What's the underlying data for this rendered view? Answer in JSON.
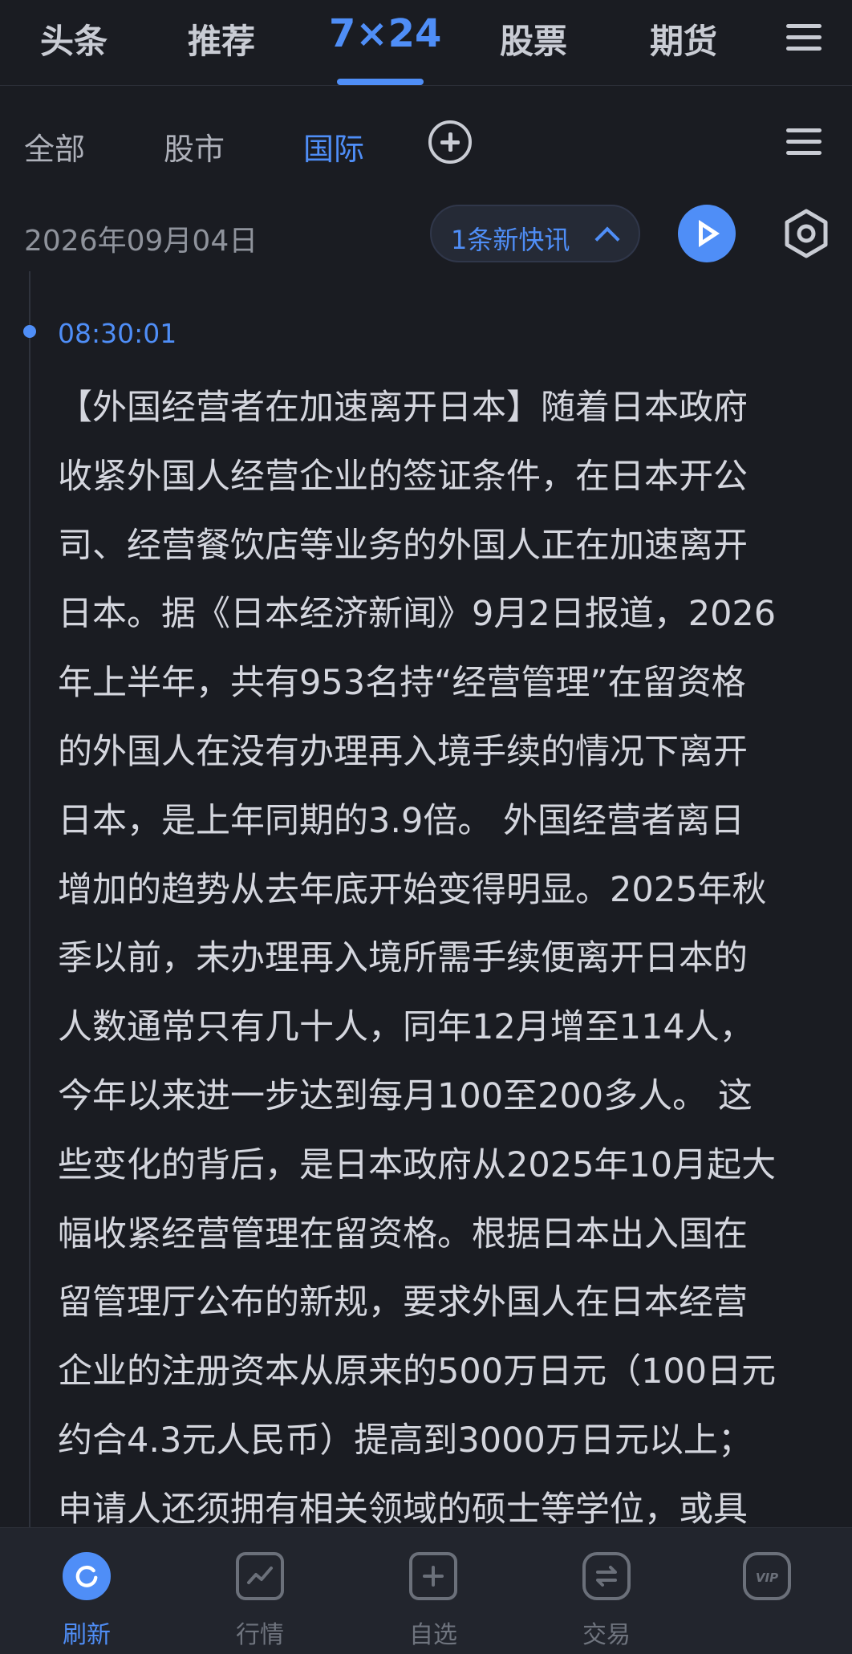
{
  "top_nav": {
    "tabs": [
      {
        "label": "头条"
      },
      {
        "label": "推荐"
      },
      {
        "label": "7×24"
      },
      {
        "label": "股票"
      },
      {
        "label": "期货"
      }
    ],
    "active_index": 2,
    "menu_icon": "hamburger-menu-icon"
  },
  "sub_nav": {
    "tabs": [
      {
        "label": "全部"
      },
      {
        "label": "股市"
      },
      {
        "label": "国际"
      }
    ],
    "active_index": 2,
    "add_icon": "plus-circle-icon",
    "menu_icon": "hamburger-menu-icon"
  },
  "toolbar": {
    "date": "2026年09月04日",
    "new_flash_label": "1条新快讯",
    "play_icon": "play-icon",
    "settings_icon": "hexagon-settings-icon"
  },
  "news": {
    "time": "08:30:01",
    "lines": [
      "【外国经营者在加速离开日本】随着日本政府",
      "收紧外国人经营企业的签证条件，在日本开公",
      "司、经营餐饮店等业务的外国人正在加速离开",
      "日本。据《日本经济新闻》9月2日报道，2026",
      "年上半年，共有953名持“经营管理”在留资格",
      "的外国人在没有办理再入境手续的情况下离开",
      "日本，是上年同期的3.9倍。 外国经营者离日",
      "增加的趋势从去年底开始变得明显。2025年秋",
      "季以前，未办理再入境所需手续便离开日本的",
      "人数通常只有几十人，同年12月增至114人，",
      "今年以来进一步达到每月100至200多人。 这",
      "些变化的背后，是日本政府从2025年10月起大",
      "幅收紧经营管理在留资格。根据日本出入国在",
      "留管理厅公布的新规，要求外国人在日本经营",
      "企业的注册资本从原来的500万日元（100日元",
      "约合4.3元人民币）提高到3000万日元以上；",
      "申请人还须拥有相关领域的硕士等学位，或具"
    ]
  },
  "bottom_nav": {
    "items": [
      {
        "label": "刷新",
        "icon": "refresh-icon"
      },
      {
        "label": "行情",
        "icon": "market-chart-icon"
      },
      {
        "label": "自选",
        "icon": "add-watchlist-icon"
      },
      {
        "label": "交易",
        "icon": "trade-exchange-icon"
      },
      {
        "label": "VIP",
        "icon": "vip-icon"
      }
    ],
    "active_index": 0
  },
  "colors": {
    "background": "#1a1c22",
    "accent": "#4f8ef7",
    "text": "#d4d6de",
    "muted": "#8f939c"
  }
}
